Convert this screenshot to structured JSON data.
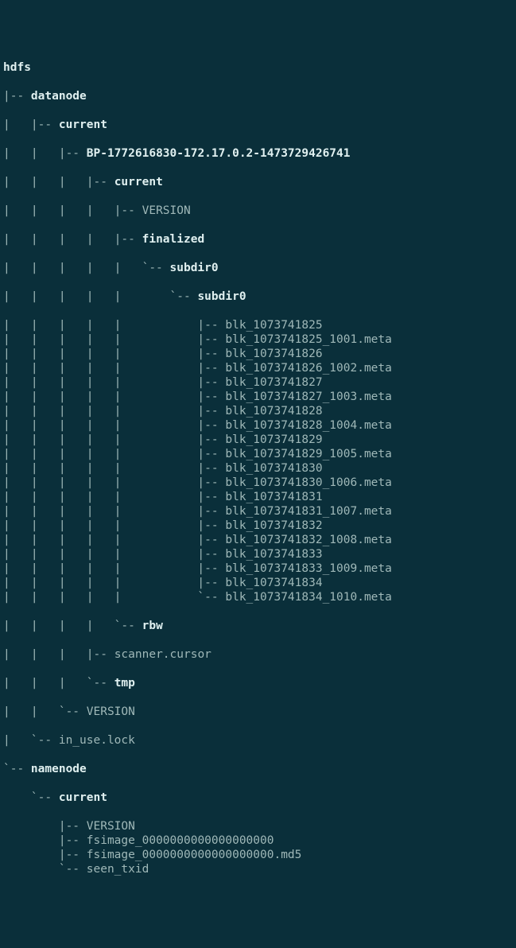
{
  "root": "hdfs",
  "tree": {
    "datanode": {
      "name": "datanode",
      "current": {
        "name": "current",
        "bp": {
          "name": "BP-1772616830-172.17.0.2-1473729426741",
          "current": {
            "name": "current",
            "version": "VERSION",
            "finalized": {
              "name": "finalized",
              "subdir0a": {
                "name": "subdir0",
                "subdir0b": {
                  "name": "subdir0",
                  "files": [
                    "blk_1073741825",
                    "blk_1073741825_1001.meta",
                    "blk_1073741826",
                    "blk_1073741826_1002.meta",
                    "blk_1073741827",
                    "blk_1073741827_1003.meta",
                    "blk_1073741828",
                    "blk_1073741828_1004.meta",
                    "blk_1073741829",
                    "blk_1073741829_1005.meta",
                    "blk_1073741830",
                    "blk_1073741830_1006.meta",
                    "blk_1073741831",
                    "blk_1073741831_1007.meta",
                    "blk_1073741832",
                    "blk_1073741832_1008.meta",
                    "blk_1073741833",
                    "blk_1073741833_1009.meta",
                    "blk_1073741834",
                    "blk_1073741834_1010.meta"
                  ]
                }
              }
            },
            "rbw": "rbw"
          },
          "scanner": "scanner.cursor",
          "tmp": "tmp"
        },
        "version": "VERSION"
      },
      "inuse": "in_use.lock"
    },
    "namenode": {
      "name": "namenode",
      "current": {
        "name": "current",
        "files": [
          "VERSION",
          "fsimage_0000000000000000000",
          "fsimage_0000000000000000000.md5",
          "seen_txid"
        ]
      }
    }
  }
}
